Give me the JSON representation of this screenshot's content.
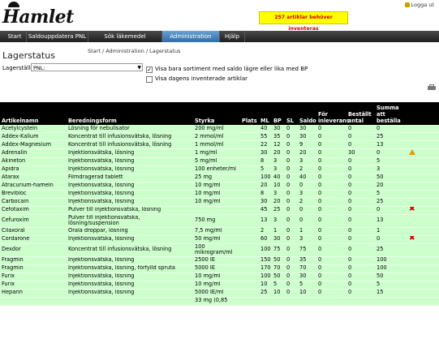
{
  "header": {
    "logo_text": "Hamlet",
    "alert_text": "257 artiklar behöver inventeras",
    "logout_label": "Logga ut"
  },
  "nav": [
    "Start",
    "Saldouppdatera PNL",
    "Sök läkemedel",
    "Administration",
    "Hjälp"
  ],
  "page": {
    "title": "Lagerstatus",
    "breadcrumb": "Start / Administration / Lagerstatus",
    "lagerstalle_label": "Lagerställe",
    "lagerstalle_value": "PNL:",
    "checkbox1_label": "Visa bara sortiment med saldo lägre eller lika med BP",
    "checkbox1_checked": true,
    "checkbox2_label": "Visa dagens inventerade artiklar",
    "checkbox2_checked": false
  },
  "table": {
    "headers": [
      "Artikelnamn",
      "Beredningsform",
      "Styrka",
      "Plats",
      "ML",
      "BP",
      "SL",
      "Saldo",
      "För inleverans",
      "Beställt antal",
      "Summa att beställa",
      ""
    ],
    "rows": [
      [
        "Acetylcystein",
        "Lösning för nebulisator",
        "200 mg/ml",
        "",
        "40",
        "30",
        "0",
        "30",
        "0",
        "0",
        "0",
        ""
      ],
      [
        "Addex-Kalium",
        "Koncentrat till infusionsvätska, lösning",
        "2 mmol/ml",
        "",
        "55",
        "35",
        "0",
        "30",
        "0",
        "0",
        "25",
        ""
      ],
      [
        "Addex-Magnesium",
        "Koncentrat till infusionsvätska, lösning",
        "1 mmol/ml",
        "",
        "22",
        "12",
        "0",
        "9",
        "0",
        "0",
        "13",
        ""
      ],
      [
        "Adrenalin",
        "Injektionsvätska, lösning",
        "1 mg/ml",
        "",
        "30",
        "20",
        "0",
        "20",
        "0",
        "30",
        "0",
        "warning-icon"
      ],
      [
        "Akineton",
        "Injektionsvätska, lösning",
        "5 mg/ml",
        "",
        "8",
        "3",
        "0",
        "3",
        "0",
        "0",
        "5",
        ""
      ],
      [
        "Apidra",
        "Injektionsvätska, lösning",
        "100 enheter/ml",
        "",
        "5",
        "3",
        "0",
        "2",
        "0",
        "0",
        "3",
        ""
      ],
      [
        "Atarax",
        "Filmdragerad tablett",
        "25 mg",
        "",
        "100",
        "40",
        "0",
        "40",
        "0",
        "0",
        "50",
        ""
      ],
      [
        "Atracurium-hameln",
        "Injektionsvätska, lösning",
        "10 mg/ml",
        "",
        "20",
        "10",
        "0",
        "0",
        "0",
        "0",
        "20",
        ""
      ],
      [
        "Brevibloc",
        "Injektionsvätska, lösning",
        "10 mg/ml",
        "",
        "8",
        "3",
        "0",
        "3",
        "0",
        "0",
        "5",
        ""
      ],
      [
        "Carbocain",
        "Injektionsvätska, lösning",
        "10 mg/ml",
        "",
        "30",
        "20",
        "0",
        "2",
        "0",
        "0",
        "25",
        ""
      ],
      [
        "Cefotaxim",
        "Pulver till injektionsvätska, lösning",
        "",
        "",
        "45",
        "25",
        "0",
        "0",
        "0",
        "0",
        "0",
        "remove-icon"
      ],
      [
        "Cefuroxim",
        "Pulver till injektionsvätska, lösning/suspension",
        "750 mg",
        "",
        "13",
        "3",
        "0",
        "0",
        "0",
        "0",
        "13",
        ""
      ],
      [
        "Cilaxoral",
        "Orala droppar, lösning",
        "7,5 mg/ml",
        "",
        "2",
        "1",
        "0",
        "1",
        "0",
        "0",
        "1",
        ""
      ],
      [
        "Cordarone",
        "Injektionsvätska, lösning",
        "50 mg/ml",
        "",
        "60",
        "30",
        "0",
        "3",
        "0",
        "0",
        "0",
        "remove-icon"
      ],
      [
        "Dexdor",
        "Koncentrat till infusionsvätska, lösning",
        "100 mikrogram/ml",
        "",
        "100",
        "75",
        "0",
        "75",
        "0",
        "0",
        "25",
        ""
      ],
      [
        "Fragmin",
        "Injektionsvätska, lösning",
        "2500 IE",
        "",
        "150",
        "50",
        "0",
        "35",
        "0",
        "0",
        "100",
        ""
      ],
      [
        "Fragmin",
        "Injektionsvätska, lösning, förfylld spruta",
        "5000 IE",
        "",
        "170",
        "70",
        "0",
        "70",
        "0",
        "0",
        "100",
        ""
      ],
      [
        "Furix",
        "Injektionsvätska, lösning",
        "10 mg/ml",
        "",
        "100",
        "50",
        "0",
        "30",
        "0",
        "0",
        "50",
        ""
      ],
      [
        "Furix",
        "Injektionsvätska, lösning",
        "10 mg/ml",
        "",
        "10",
        "5",
        "0",
        "5",
        "0",
        "0",
        "5",
        ""
      ],
      [
        "Heparin",
        "Injektionsvätska, lösning",
        "5000 IE/ml",
        "",
        "25",
        "10",
        "0",
        "10",
        "0",
        "0",
        "15",
        ""
      ],
      [
        "",
        "",
        "33 mg (0,85",
        "",
        "",
        "",
        "",
        "",
        "",
        "",
        "",
        ""
      ]
    ]
  }
}
